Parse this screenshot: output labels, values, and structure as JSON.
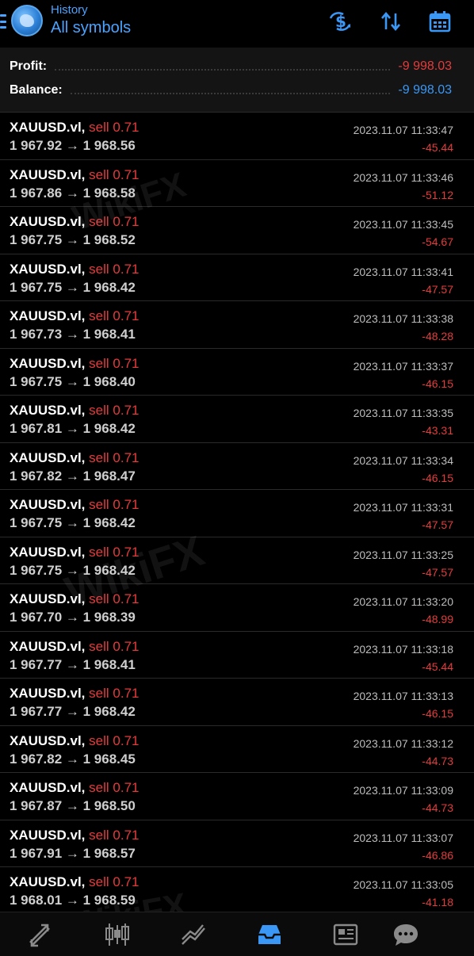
{
  "header": {
    "subtitle": "History",
    "title": "All symbols",
    "icons": [
      "menu-icon",
      "app-logo",
      "currency-exchange-icon",
      "sort-icon",
      "calendar-icon"
    ]
  },
  "summary": {
    "profit_label": "Profit:",
    "profit_value": "-9 998.03",
    "balance_label": "Balance:",
    "balance_value": "-9 998.03",
    "colors": {
      "profit": "#e43b3b",
      "balance": "#3b97f5"
    }
  },
  "trades": [
    {
      "symbol": "XAUUSD.vl,",
      "side": "sell 0.71",
      "prices": "1 967.92 → 1 968.56",
      "time": "2023.11.07 11:33:47",
      "profit": "-45.44"
    },
    {
      "symbol": "XAUUSD.vl,",
      "side": "sell 0.71",
      "prices": "1 967.86 → 1 968.58",
      "time": "2023.11.07 11:33:46",
      "profit": "-51.12"
    },
    {
      "symbol": "XAUUSD.vl,",
      "side": "sell 0.71",
      "prices": "1 967.75 → 1 968.52",
      "time": "2023.11.07 11:33:45",
      "profit": "-54.67"
    },
    {
      "symbol": "XAUUSD.vl,",
      "side": "sell 0.71",
      "prices": "1 967.75 → 1 968.42",
      "time": "2023.11.07 11:33:41",
      "profit": "-47.57"
    },
    {
      "symbol": "XAUUSD.vl,",
      "side": "sell 0.71",
      "prices": "1 967.73 → 1 968.41",
      "time": "2023.11.07 11:33:38",
      "profit": "-48.28"
    },
    {
      "symbol": "XAUUSD.vl,",
      "side": "sell 0.71",
      "prices": "1 967.75 → 1 968.40",
      "time": "2023.11.07 11:33:37",
      "profit": "-46.15"
    },
    {
      "symbol": "XAUUSD.vl,",
      "side": "sell 0.71",
      "prices": "1 967.81 → 1 968.42",
      "time": "2023.11.07 11:33:35",
      "profit": "-43.31"
    },
    {
      "symbol": "XAUUSD.vl,",
      "side": "sell 0.71",
      "prices": "1 967.82 → 1 968.47",
      "time": "2023.11.07 11:33:34",
      "profit": "-46.15"
    },
    {
      "symbol": "XAUUSD.vl,",
      "side": "sell 0.71",
      "prices": "1 967.75 → 1 968.42",
      "time": "2023.11.07 11:33:31",
      "profit": "-47.57"
    },
    {
      "symbol": "XAUUSD.vl,",
      "side": "sell 0.71",
      "prices": "1 967.75 → 1 968.42",
      "time": "2023.11.07 11:33:25",
      "profit": "-47.57"
    },
    {
      "symbol": "XAUUSD.vl,",
      "side": "sell 0.71",
      "prices": "1 967.70 → 1 968.39",
      "time": "2023.11.07 11:33:20",
      "profit": "-48.99"
    },
    {
      "symbol": "XAUUSD.vl,",
      "side": "sell 0.71",
      "prices": "1 967.77 → 1 968.41",
      "time": "2023.11.07 11:33:18",
      "profit": "-45.44"
    },
    {
      "symbol": "XAUUSD.vl,",
      "side": "sell 0.71",
      "prices": "1 967.77 → 1 968.42",
      "time": "2023.11.07 11:33:13",
      "profit": "-46.15"
    },
    {
      "symbol": "XAUUSD.vl,",
      "side": "sell 0.71",
      "prices": "1 967.82 → 1 968.45",
      "time": "2023.11.07 11:33:12",
      "profit": "-44.73"
    },
    {
      "symbol": "XAUUSD.vl,",
      "side": "sell 0.71",
      "prices": "1 967.87 → 1 968.50",
      "time": "2023.11.07 11:33:09",
      "profit": "-44.73"
    },
    {
      "symbol": "XAUUSD.vl,",
      "side": "sell 0.71",
      "prices": "1 967.91 → 1 968.57",
      "time": "2023.11.07 11:33:07",
      "profit": "-46.86"
    },
    {
      "symbol": "XAUUSD.vl,",
      "side": "sell 0.71",
      "prices": "1 968.01 → 1 968.59",
      "time": "2023.11.07 11:33:05",
      "profit": "-41.18"
    }
  ],
  "watermark": {
    "text": "WikiFX"
  },
  "bottom_nav": {
    "items": [
      "quotes-icon",
      "chart-icon",
      "trade-icon",
      "history-icon",
      "news-icon",
      "chat-icon"
    ],
    "active": "history-icon",
    "colors": {
      "active": "#3b97f5",
      "inactive": "#8a8a8a"
    }
  }
}
